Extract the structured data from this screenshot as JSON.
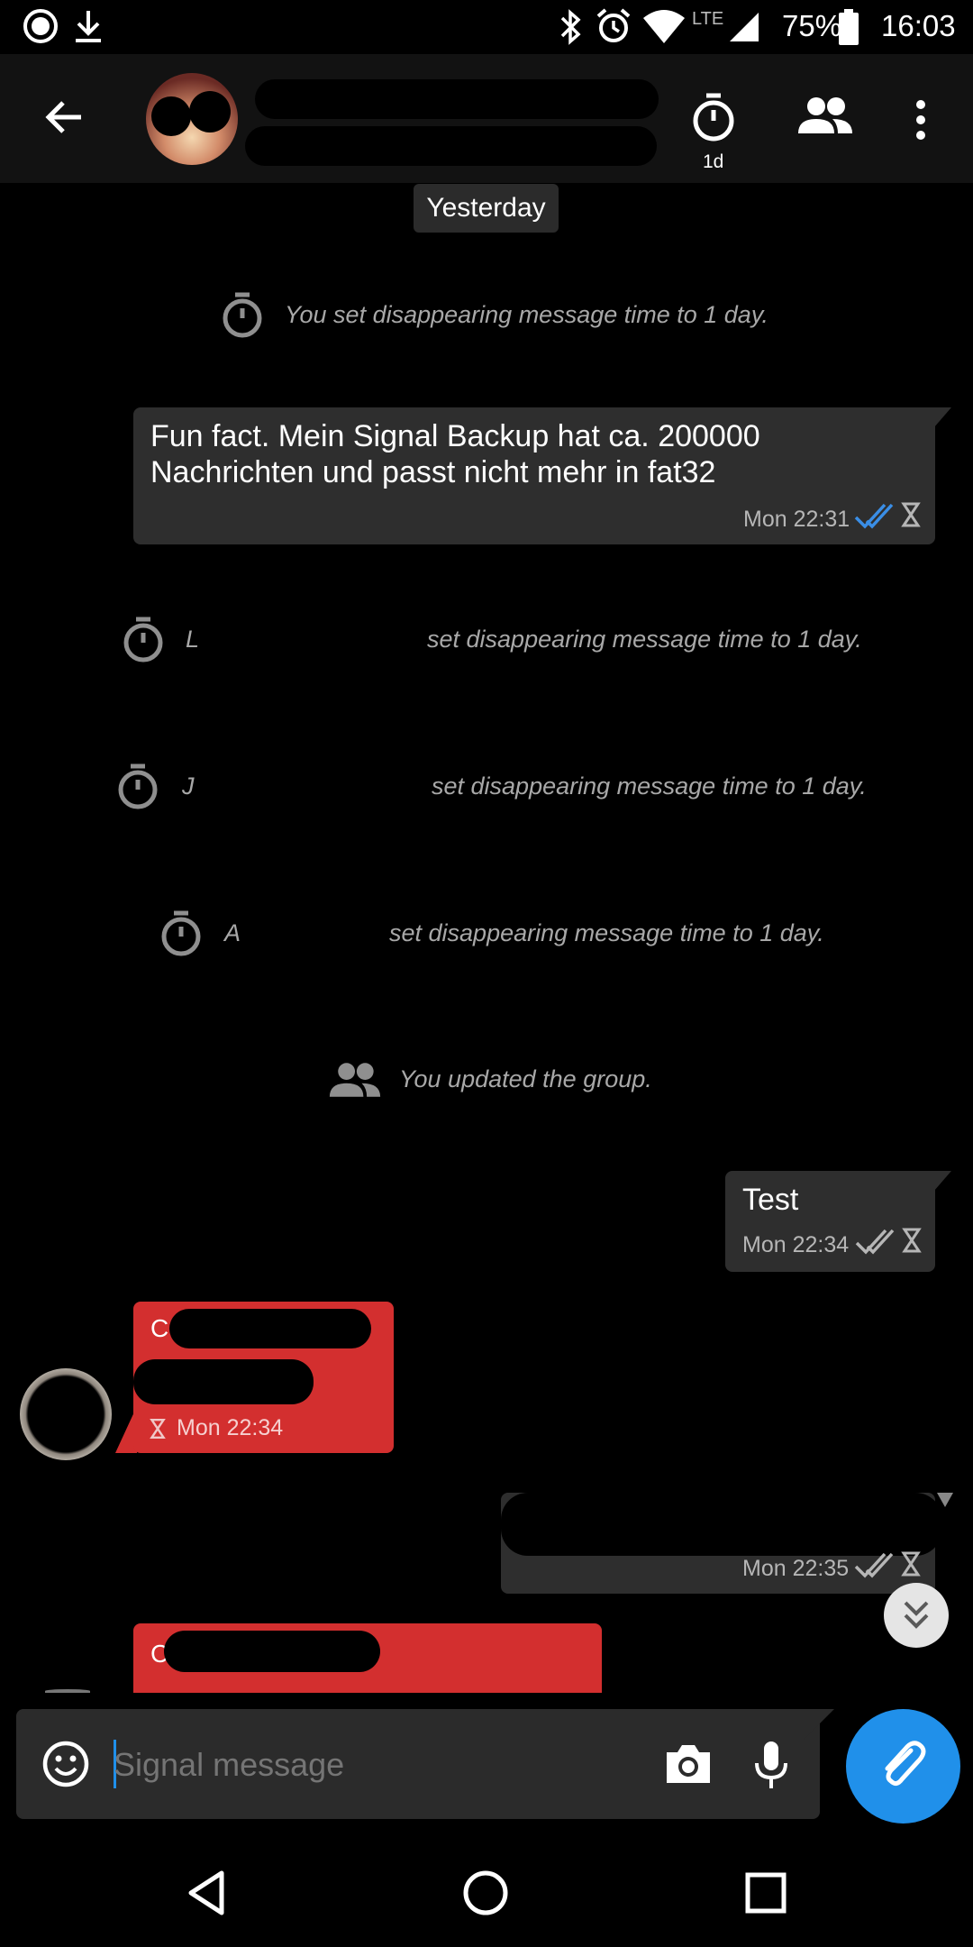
{
  "status_bar": {
    "lte_label": "LTE",
    "battery_text": "75%",
    "time": "16:03"
  },
  "toolbar": {
    "timer_label": "1d"
  },
  "conversation": {
    "date_divider": "Yesterday",
    "system_messages": [
      {
        "prefix": "",
        "text": "You set disappearing message time to 1 day."
      },
      {
        "prefix": "L",
        "text": "set disappearing message time to 1 day."
      },
      {
        "prefix": "J",
        "text": "set disappearing message time to 1 day."
      },
      {
        "prefix": "A",
        "text": "set disappearing message time to 1 day."
      },
      {
        "prefix": "",
        "text": "You updated the group."
      }
    ],
    "messages": [
      {
        "text_line1": "Fun fact. Mein Signal Backup hat ca. 200000",
        "text_line2": "Nachrichten und passt nicht mehr in fat32",
        "time": "Mon 22:31"
      },
      {
        "text": "Test",
        "time": "Mon 22:34"
      },
      {
        "sender_initial": "C",
        "time": "Mon 22:34"
      },
      {
        "time": "Mon 22:35"
      },
      {
        "sender_initial": "C"
      }
    ]
  },
  "compose": {
    "placeholder": "Signal message"
  },
  "colors": {
    "incoming_bubble": "#d32f2f",
    "outgoing_bubble": "#2e2e2e",
    "accent": "#2090ea",
    "read_check": "#3a8ee6"
  }
}
